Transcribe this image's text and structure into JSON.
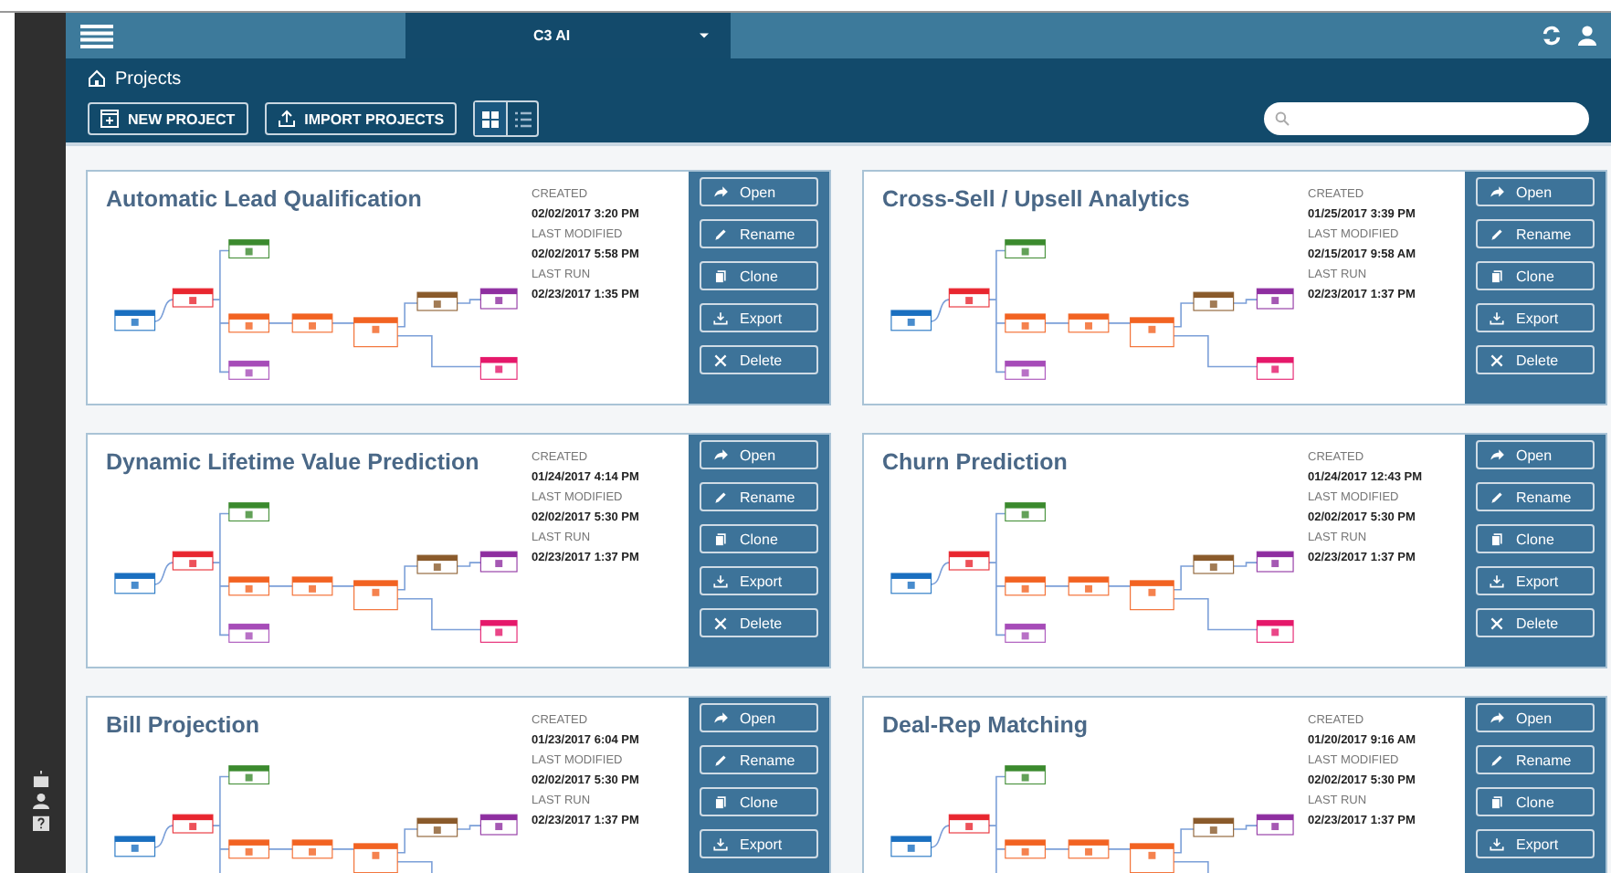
{
  "top_bar": {
    "app_tab": "C3 AI"
  },
  "breadcrumb": "Projects",
  "toolbar": {
    "buttons": [
      "NEW PROJECT",
      "IMPORT PROJECTS"
    ],
    "views": [
      {
        "selected": true
      },
      {
        "selected": false
      }
    ]
  },
  "projects": [
    {
      "title": "Automatic Lead Qualification",
      "meta": [
        {
          "label": "CREATED",
          "value": "02/02/2017 3:20 PM"
        },
        {
          "label": "LAST MODIFIED",
          "value": "02/02/2017 5:58 PM"
        },
        {
          "label": "LAST RUN",
          "value": "02/23/2017 1:35 PM"
        }
      ],
      "actions": [
        "Open",
        "Rename",
        "Clone",
        "Export",
        "Delete"
      ]
    },
    {
      "title": "Cross-Sell / Upsell Analytics",
      "meta": [
        {
          "label": "CREATED",
          "value": "01/25/2017 3:39 PM"
        },
        {
          "label": "LAST MODIFIED",
          "value": "02/15/2017 9:58 AM"
        },
        {
          "label": "LAST RUN",
          "value": "02/23/2017 1:37 PM"
        }
      ],
      "actions": [
        "Open",
        "Rename",
        "Clone",
        "Export",
        "Delete"
      ]
    },
    {
      "title": "Dynamic Lifetime Value Prediction",
      "meta": [
        {
          "label": "CREATED",
          "value": "01/24/2017 4:14 PM"
        },
        {
          "label": "LAST MODIFIED",
          "value": "02/02/2017 5:30 PM"
        },
        {
          "label": "LAST RUN",
          "value": "02/23/2017 1:37 PM"
        }
      ],
      "actions": [
        "Open",
        "Rename",
        "Clone",
        "Export",
        "Delete"
      ]
    },
    {
      "title": "Churn Prediction",
      "meta": [
        {
          "label": "CREATED",
          "value": "01/24/2017 12:43 PM"
        },
        {
          "label": "LAST MODIFIED",
          "value": "02/02/2017 5:30 PM"
        },
        {
          "label": "LAST RUN",
          "value": "02/23/2017 1:37 PM"
        }
      ],
      "actions": [
        "Open",
        "Rename",
        "Clone",
        "Export",
        "Delete"
      ]
    },
    {
      "title": "Bill Projection",
      "meta": [
        {
          "label": "CREATED",
          "value": "01/23/2017 6:04 PM"
        },
        {
          "label": "LAST MODIFIED",
          "value": "02/02/2017 5:30 PM"
        },
        {
          "label": "LAST RUN",
          "value": "02/23/2017 1:37 PM"
        }
      ],
      "actions": [
        "Open",
        "Rename",
        "Clone",
        "Export"
      ]
    },
    {
      "title": "Deal-Rep Matching",
      "meta": [
        {
          "label": "CREATED",
          "value": "01/20/2017 9:16 AM"
        },
        {
          "label": "LAST MODIFIED",
          "value": "02/02/2017 5:30 PM"
        },
        {
          "label": "LAST RUN",
          "value": "02/23/2017 1:37 PM"
        }
      ],
      "actions": [
        "Open",
        "Rename",
        "Clone",
        "Export"
      ]
    }
  ]
}
